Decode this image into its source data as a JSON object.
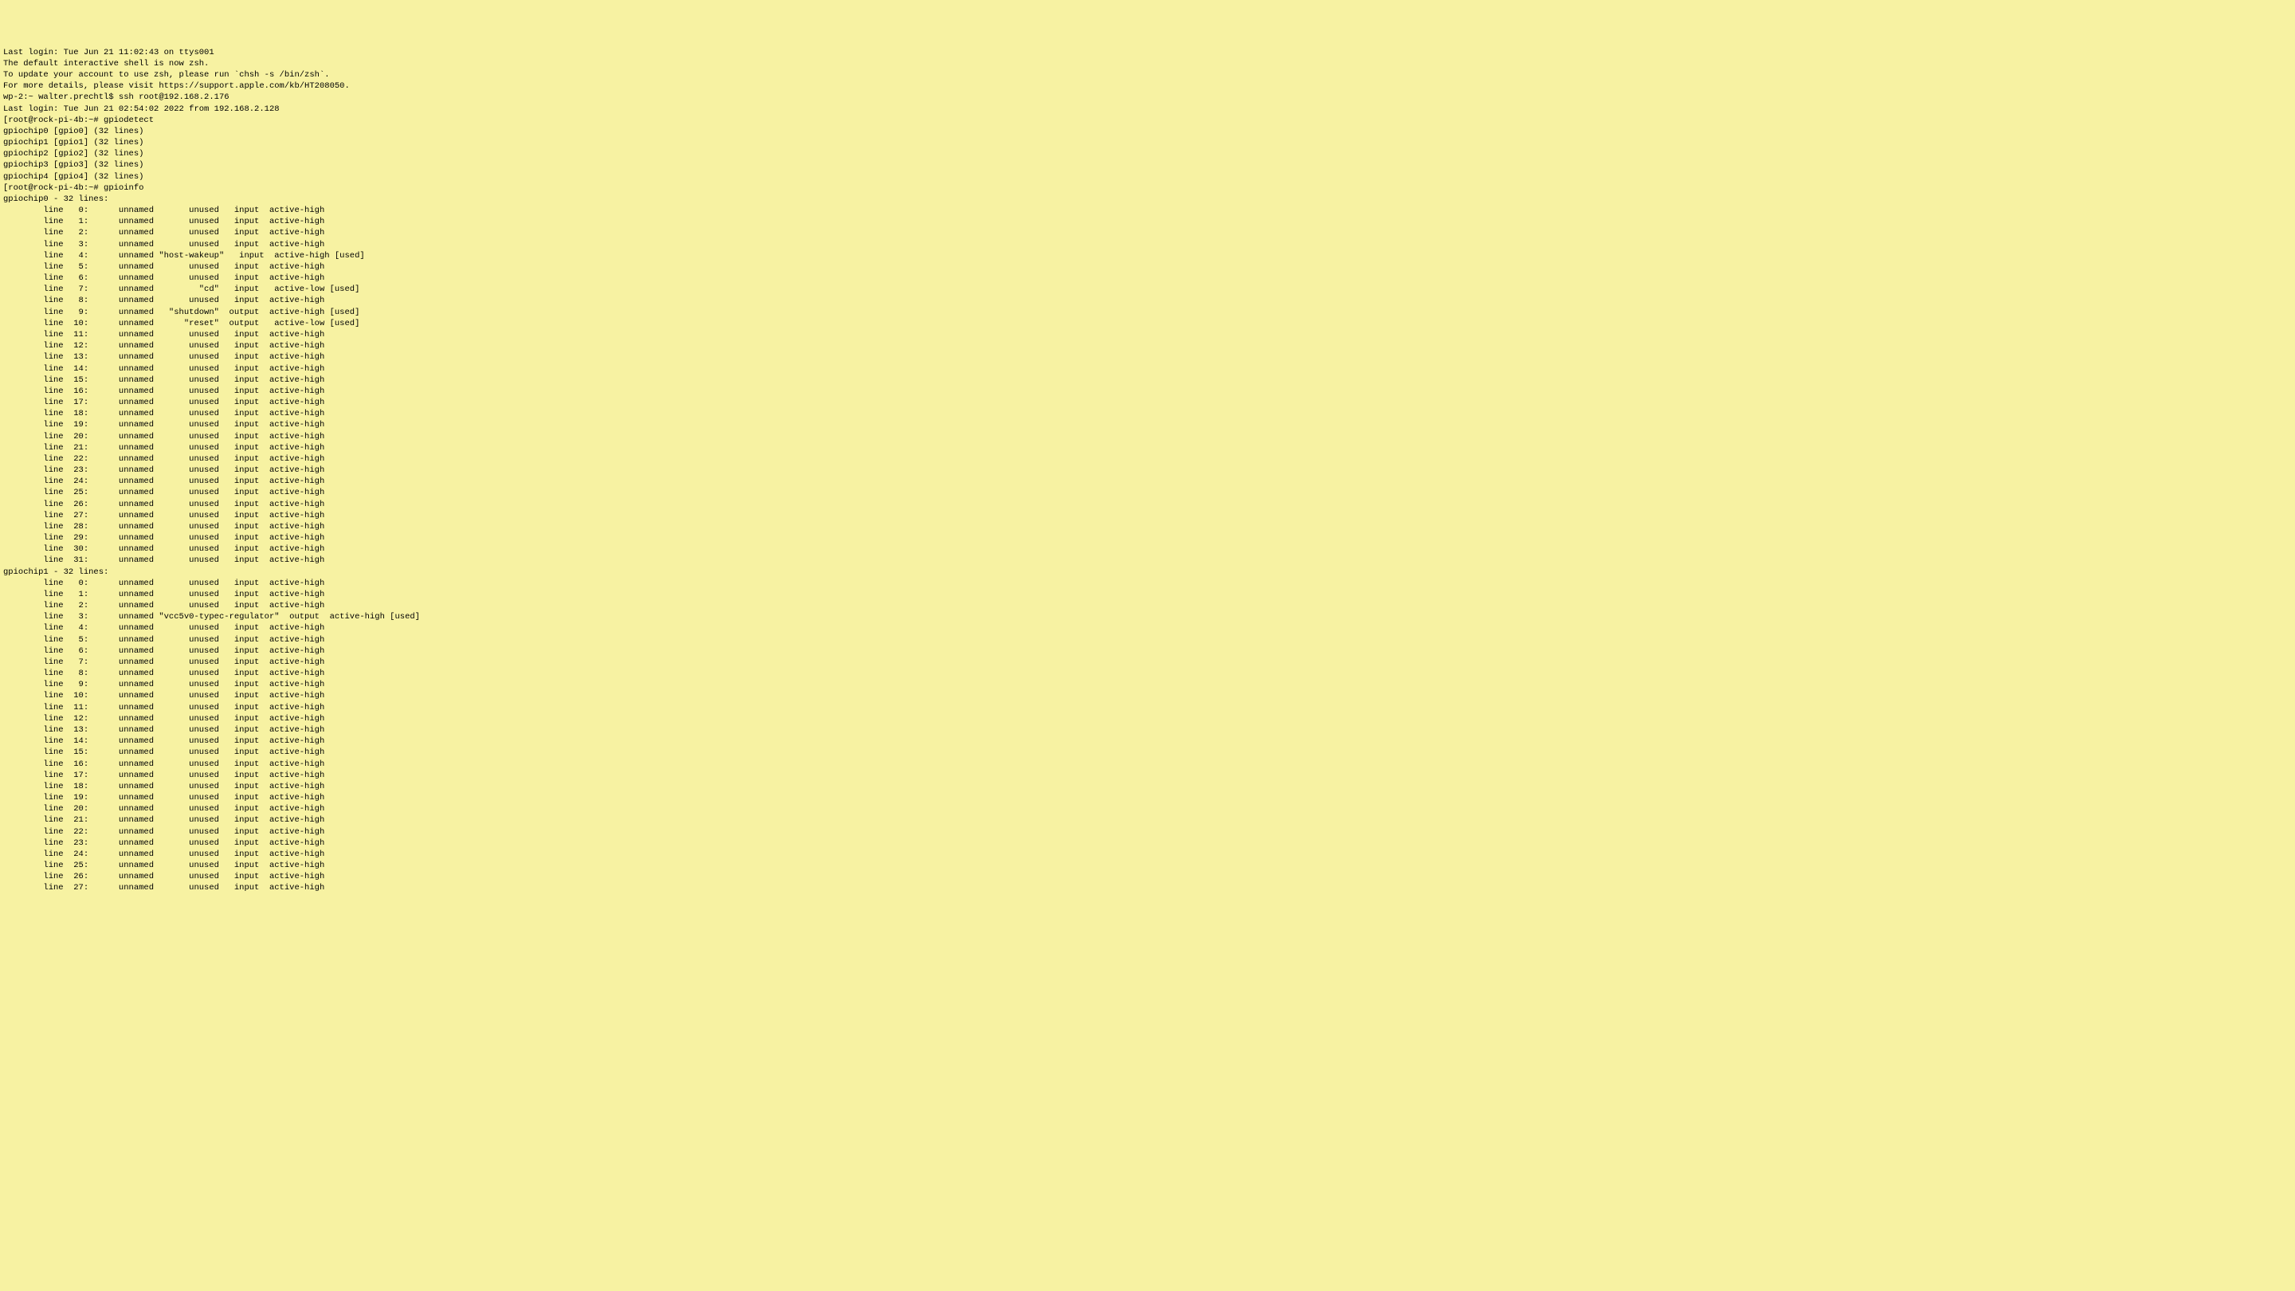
{
  "terminal": {
    "header": [
      "Last login: Tue Jun 21 11:02:43 on ttys001",
      "",
      "The default interactive shell is now zsh.",
      "To update your account to use zsh, please run `chsh -s /bin/zsh`.",
      "For more details, please visit https://support.apple.com/kb/HT208050.",
      "wp-2:~ walter.prechtl$ ssh root@192.168.2.176",
      "Last login: Tue Jun 21 02:54:02 2022 from 192.168.2.128"
    ],
    "prompt1": "[root@rock-pi-4b:~# gpiodetect",
    "gpiodetect": [
      "gpiochip0 [gpio0] (32 lines)",
      "gpiochip1 [gpio1] (32 lines)",
      "gpiochip2 [gpio2] (32 lines)",
      "gpiochip3 [gpio3] (32 lines)",
      "gpiochip4 [gpio4] (32 lines)"
    ],
    "prompt2": "[root@rock-pi-4b:~# gpioinfo",
    "chip0_header": "gpiochip0 - 32 lines:",
    "chip0_lines": [
      {
        "n": 0,
        "name": "unnamed",
        "consumer": "unused",
        "dir": "input",
        "active": "active-high",
        "used": false
      },
      {
        "n": 1,
        "name": "unnamed",
        "consumer": "unused",
        "dir": "input",
        "active": "active-high",
        "used": false
      },
      {
        "n": 2,
        "name": "unnamed",
        "consumer": "unused",
        "dir": "input",
        "active": "active-high",
        "used": false
      },
      {
        "n": 3,
        "name": "unnamed",
        "consumer": "unused",
        "dir": "input",
        "active": "active-high",
        "used": false
      },
      {
        "n": 4,
        "name": "unnamed",
        "consumer": "\"host-wakeup\"",
        "dir": "input",
        "active": "active-high",
        "used": true
      },
      {
        "n": 5,
        "name": "unnamed",
        "consumer": "unused",
        "dir": "input",
        "active": "active-high",
        "used": false
      },
      {
        "n": 6,
        "name": "unnamed",
        "consumer": "unused",
        "dir": "input",
        "active": "active-high",
        "used": false
      },
      {
        "n": 7,
        "name": "unnamed",
        "consumer": "\"cd\"",
        "dir": "input",
        "active": "active-low",
        "used": true
      },
      {
        "n": 8,
        "name": "unnamed",
        "consumer": "unused",
        "dir": "input",
        "active": "active-high",
        "used": false
      },
      {
        "n": 9,
        "name": "unnamed",
        "consumer": "\"shutdown\"",
        "dir": "output",
        "active": "active-high",
        "used": true
      },
      {
        "n": 10,
        "name": "unnamed",
        "consumer": "\"reset\"",
        "dir": "output",
        "active": "active-low",
        "used": true
      },
      {
        "n": 11,
        "name": "unnamed",
        "consumer": "unused",
        "dir": "input",
        "active": "active-high",
        "used": false
      },
      {
        "n": 12,
        "name": "unnamed",
        "consumer": "unused",
        "dir": "input",
        "active": "active-high",
        "used": false
      },
      {
        "n": 13,
        "name": "unnamed",
        "consumer": "unused",
        "dir": "input",
        "active": "active-high",
        "used": false
      },
      {
        "n": 14,
        "name": "unnamed",
        "consumer": "unused",
        "dir": "input",
        "active": "active-high",
        "used": false
      },
      {
        "n": 15,
        "name": "unnamed",
        "consumer": "unused",
        "dir": "input",
        "active": "active-high",
        "used": false
      },
      {
        "n": 16,
        "name": "unnamed",
        "consumer": "unused",
        "dir": "input",
        "active": "active-high",
        "used": false
      },
      {
        "n": 17,
        "name": "unnamed",
        "consumer": "unused",
        "dir": "input",
        "active": "active-high",
        "used": false
      },
      {
        "n": 18,
        "name": "unnamed",
        "consumer": "unused",
        "dir": "input",
        "active": "active-high",
        "used": false
      },
      {
        "n": 19,
        "name": "unnamed",
        "consumer": "unused",
        "dir": "input",
        "active": "active-high",
        "used": false
      },
      {
        "n": 20,
        "name": "unnamed",
        "consumer": "unused",
        "dir": "input",
        "active": "active-high",
        "used": false
      },
      {
        "n": 21,
        "name": "unnamed",
        "consumer": "unused",
        "dir": "input",
        "active": "active-high",
        "used": false
      },
      {
        "n": 22,
        "name": "unnamed",
        "consumer": "unused",
        "dir": "input",
        "active": "active-high",
        "used": false
      },
      {
        "n": 23,
        "name": "unnamed",
        "consumer": "unused",
        "dir": "input",
        "active": "active-high",
        "used": false
      },
      {
        "n": 24,
        "name": "unnamed",
        "consumer": "unused",
        "dir": "input",
        "active": "active-high",
        "used": false
      },
      {
        "n": 25,
        "name": "unnamed",
        "consumer": "unused",
        "dir": "input",
        "active": "active-high",
        "used": false
      },
      {
        "n": 26,
        "name": "unnamed",
        "consumer": "unused",
        "dir": "input",
        "active": "active-high",
        "used": false
      },
      {
        "n": 27,
        "name": "unnamed",
        "consumer": "unused",
        "dir": "input",
        "active": "active-high",
        "used": false
      },
      {
        "n": 28,
        "name": "unnamed",
        "consumer": "unused",
        "dir": "input",
        "active": "active-high",
        "used": false
      },
      {
        "n": 29,
        "name": "unnamed",
        "consumer": "unused",
        "dir": "input",
        "active": "active-high",
        "used": false
      },
      {
        "n": 30,
        "name": "unnamed",
        "consumer": "unused",
        "dir": "input",
        "active": "active-high",
        "used": false
      },
      {
        "n": 31,
        "name": "unnamed",
        "consumer": "unused",
        "dir": "input",
        "active": "active-high",
        "used": false
      }
    ],
    "chip1_header": "gpiochip1 - 32 lines:",
    "chip1_lines": [
      {
        "n": 0,
        "name": "unnamed",
        "consumer": "unused",
        "dir": "input",
        "active": "active-high",
        "used": false
      },
      {
        "n": 1,
        "name": "unnamed",
        "consumer": "unused",
        "dir": "input",
        "active": "active-high",
        "used": false
      },
      {
        "n": 2,
        "name": "unnamed",
        "consumer": "unused",
        "dir": "input",
        "active": "active-high",
        "used": false
      },
      {
        "n": 3,
        "name": "unnamed",
        "consumer": "\"vcc5v0-typec-regulator\"",
        "dir": "output",
        "active": "active-high",
        "used": true
      },
      {
        "n": 4,
        "name": "unnamed",
        "consumer": "unused",
        "dir": "input",
        "active": "active-high",
        "used": false
      },
      {
        "n": 5,
        "name": "unnamed",
        "consumer": "unused",
        "dir": "input",
        "active": "active-high",
        "used": false
      },
      {
        "n": 6,
        "name": "unnamed",
        "consumer": "unused",
        "dir": "input",
        "active": "active-high",
        "used": false
      },
      {
        "n": 7,
        "name": "unnamed",
        "consumer": "unused",
        "dir": "input",
        "active": "active-high",
        "used": false
      },
      {
        "n": 8,
        "name": "unnamed",
        "consumer": "unused",
        "dir": "input",
        "active": "active-high",
        "used": false
      },
      {
        "n": 9,
        "name": "unnamed",
        "consumer": "unused",
        "dir": "input",
        "active": "active-high",
        "used": false
      },
      {
        "n": 10,
        "name": "unnamed",
        "consumer": "unused",
        "dir": "input",
        "active": "active-high",
        "used": false
      },
      {
        "n": 11,
        "name": "unnamed",
        "consumer": "unused",
        "dir": "input",
        "active": "active-high",
        "used": false
      },
      {
        "n": 12,
        "name": "unnamed",
        "consumer": "unused",
        "dir": "input",
        "active": "active-high",
        "used": false
      },
      {
        "n": 13,
        "name": "unnamed",
        "consumer": "unused",
        "dir": "input",
        "active": "active-high",
        "used": false
      },
      {
        "n": 14,
        "name": "unnamed",
        "consumer": "unused",
        "dir": "input",
        "active": "active-high",
        "used": false
      },
      {
        "n": 15,
        "name": "unnamed",
        "consumer": "unused",
        "dir": "input",
        "active": "active-high",
        "used": false
      },
      {
        "n": 16,
        "name": "unnamed",
        "consumer": "unused",
        "dir": "input",
        "active": "active-high",
        "used": false
      },
      {
        "n": 17,
        "name": "unnamed",
        "consumer": "unused",
        "dir": "input",
        "active": "active-high",
        "used": false
      },
      {
        "n": 18,
        "name": "unnamed",
        "consumer": "unused",
        "dir": "input",
        "active": "active-high",
        "used": false
      },
      {
        "n": 19,
        "name": "unnamed",
        "consumer": "unused",
        "dir": "input",
        "active": "active-high",
        "used": false
      },
      {
        "n": 20,
        "name": "unnamed",
        "consumer": "unused",
        "dir": "input",
        "active": "active-high",
        "used": false
      },
      {
        "n": 21,
        "name": "unnamed",
        "consumer": "unused",
        "dir": "input",
        "active": "active-high",
        "used": false
      },
      {
        "n": 22,
        "name": "unnamed",
        "consumer": "unused",
        "dir": "input",
        "active": "active-high",
        "used": false
      },
      {
        "n": 23,
        "name": "unnamed",
        "consumer": "unused",
        "dir": "input",
        "active": "active-high",
        "used": false
      },
      {
        "n": 24,
        "name": "unnamed",
        "consumer": "unused",
        "dir": "input",
        "active": "active-high",
        "used": false
      },
      {
        "n": 25,
        "name": "unnamed",
        "consumer": "unused",
        "dir": "input",
        "active": "active-high",
        "used": false
      },
      {
        "n": 26,
        "name": "unnamed",
        "consumer": "unused",
        "dir": "input",
        "active": "active-high",
        "used": false
      },
      {
        "n": 27,
        "name": "unnamed",
        "consumer": "unused",
        "dir": "input",
        "active": "active-high",
        "used": false
      }
    ]
  }
}
